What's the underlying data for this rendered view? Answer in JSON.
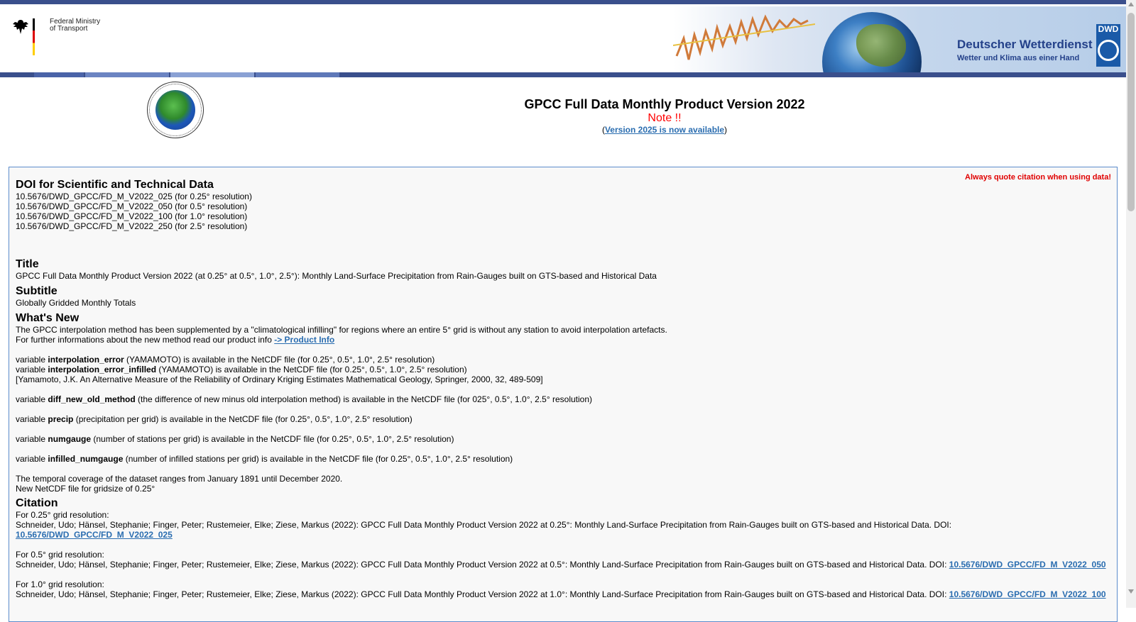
{
  "header": {
    "ministry_line1": "Federal Ministry",
    "ministry_line2": "of Transport",
    "dwd_name": "Deutscher Wetterdienst",
    "dwd_tagline": "Wetter und Klima aus einer Hand",
    "dwd_logo_text": "DWD",
    "nav_colors": [
      "#4a63a8",
      "#6b84c2",
      "#8aa1d4",
      "#5e78b8"
    ]
  },
  "page": {
    "title": "GPCC Full Data Monthly Product Version 2022",
    "note": "Note !!",
    "paren_open": "(",
    "version_link": "Version 2025 is now available",
    "paren_close": ")"
  },
  "content": {
    "quote_notice": "Always quote citation when using data!",
    "doi_heading": "DOI for Scientific and Technical Data",
    "doi_lines": [
      "10.5676/DWD_GPCC/FD_M_V2022_025 (for 0.25° resolution)",
      "10.5676/DWD_GPCC/FD_M_V2022_050 (for 0.5° resolution)",
      "10.5676/DWD_GPCC/FD_M_V2022_100 (for 1.0° resolution)",
      "10.5676/DWD_GPCC/FD_M_V2022_250 (for 2.5° resolution)"
    ],
    "title_heading": "Title",
    "title_text": "GPCC Full Data Monthly Product Version 2022 (at 0.25° at 0.5°, 1.0°, 2.5°): Monthly Land-Surface Precipitation from Rain-Gauges built on GTS-based and Historical Data",
    "subtitle_heading": "Subtitle",
    "subtitle_text": "Globally Gridded Monthly Totals",
    "whatsnew_heading": "What's New",
    "whatsnew_line1": "The GPCC interpolation method has been supplemented by a \"climatological infilling\" for regions where an entire 5° grid is without any station to avoid interpolation artefacts.",
    "whatsnew_line2": "For further informations about the new method read our product info ",
    "product_info_link": "-> Product Info",
    "var_prefix": "variable ",
    "var1_name": "interpolation_error",
    "var1_desc": " (YAMAMOTO) is available in the NetCDF file (for 0.25°, 0.5°, 1.0°, 2.5° resolution)",
    "var2_name": "interpolation_error_infilled",
    "var2_desc": " (YAMAMOTO) is available in the NetCDF file (for 0.25°, 0.5°, 1.0°, 2.5° resolution)",
    "yamamoto_ref": "[Yamamoto, J.K. An Alternative Measure of the Reliability of Ordinary Kriging Estimates Mathematical Geology, Springer, 2000, 32, 489-509]",
    "var3_name": "diff_new_old_method",
    "var3_desc": " (the difference of new minus old interpolation method) is available in the NetCDF file (for 025°, 0.5°, 1.0°, 2.5° resolution)",
    "var4_name": "precip",
    "var4_desc": " (precipitation per grid) is available in the NetCDF file (for 0.25°, 0.5°, 1.0°, 2.5° resolution)",
    "var5_name": "numgauge",
    "var5_desc": " (number of stations per grid) is available in the NetCDF file (for 0.25°, 0.5°, 1.0°, 2.5° resolution)",
    "var6_name": "infilled_numgauge",
    "var6_desc": " (number of infilled stations per grid) is available in the NetCDF file (for 0.25°, 0.5°, 1.0°, 2.5° resolution)",
    "coverage_line1": "The temporal coverage of the dataset ranges from January 1891 until December 2020.",
    "coverage_line2": "New NetCDF file for gridsize of 0.25°",
    "citation_heading": "Citation",
    "cit025_label": "For 0.25° grid resolution:",
    "cit025_text": "Schneider, Udo; Hänsel, Stephanie; Finger, Peter; Rustemeier, Elke; Ziese, Markus (2022): GPCC Full Data Monthly Product Version 2022 at 0.25°: Monthly Land-Surface Precipitation from Rain-Gauges built on GTS-based and Historical Data. DOI:",
    "cit025_link": "10.5676/DWD_GPCC/FD_M_V2022_025",
    "cit050_label": "For 0.5° grid resolution:",
    "cit050_text": "Schneider, Udo; Hänsel, Stephanie; Finger, Peter; Rustemeier, Elke; Ziese, Markus (2022): GPCC Full Data Monthly Product Version 2022 at 0.5°: Monthly Land-Surface Precipitation from Rain-Gauges built on GTS-based and Historical Data. DOI: ",
    "cit050_link": "10.5676/DWD_GPCC/FD_M_V2022_050",
    "cit100_label": "For 1.0° grid resolution:",
    "cit100_text": "Schneider, Udo; Hänsel, Stephanie; Finger, Peter; Rustemeier, Elke; Ziese, Markus (2022): GPCC Full Data Monthly Product Version 2022 at 1.0°: Monthly Land-Surface Precipitation from Rain-Gauges built on GTS-based and Historical Data. DOI: ",
    "cit100_link": "10.5676/DWD_GPCC/FD_M_V2022_100"
  }
}
